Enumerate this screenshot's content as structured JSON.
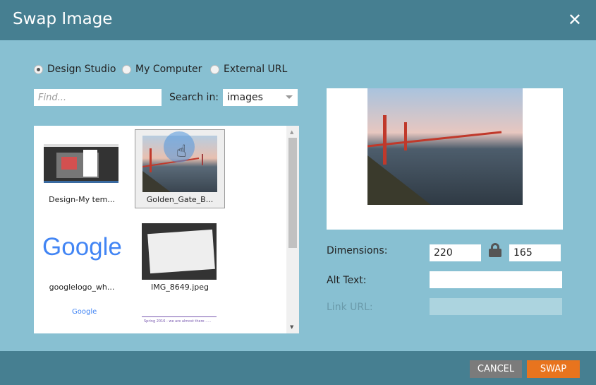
{
  "dialog": {
    "title": "Swap Image",
    "close_icon": "close-icon"
  },
  "source": {
    "options": [
      "Design Studio",
      "My Computer",
      "External URL"
    ],
    "selected": "Design Studio"
  },
  "search": {
    "placeholder": "Find...",
    "label": "Search in:",
    "folder": "images"
  },
  "images": [
    {
      "name": "Design-My tem..."
    },
    {
      "name": "Golden_Gate_B...",
      "selected": true
    },
    {
      "name": "googlelogo_wh..."
    },
    {
      "name": "IMG_8649.jpeg"
    },
    {
      "name": ""
    },
    {
      "name": ""
    }
  ],
  "logo_text": {
    "google": "Google",
    "spring": "Spring 2016 - we are almost there ....."
  },
  "details": {
    "dimensions_label": "Dimensions:",
    "width": "220",
    "height": "165",
    "alt_label": "Alt Text:",
    "alt_value": "",
    "link_label": "Link URL:",
    "link_value": ""
  },
  "footer": {
    "cancel": "CANCEL",
    "swap": "SWAP"
  },
  "colors": {
    "header": "#467f91",
    "body": "#88c0d2",
    "swap": "#e8741e",
    "cancel": "#7b7b7b"
  }
}
